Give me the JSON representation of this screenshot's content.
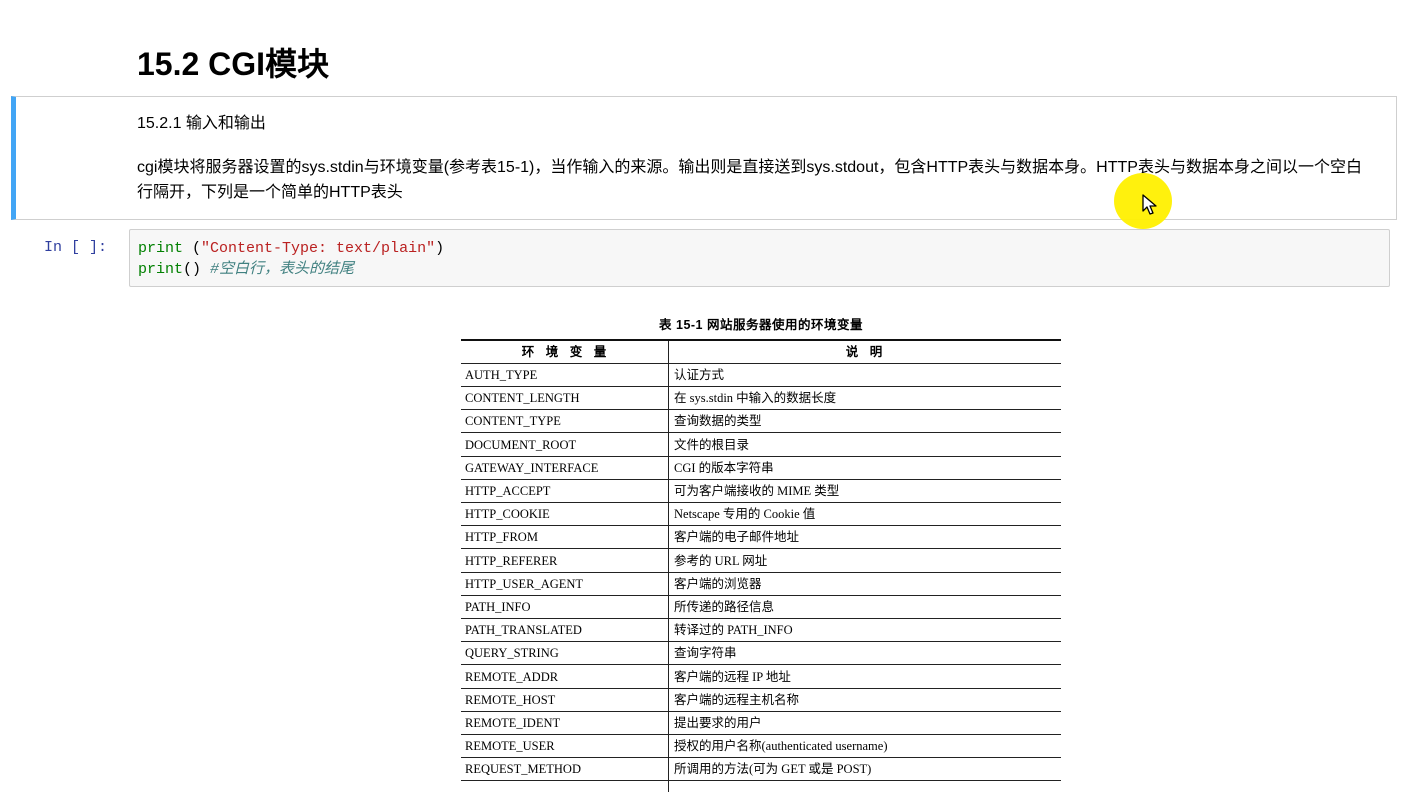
{
  "notebook": {
    "heading": "15.2 CGI模块",
    "markdown_cell": {
      "subheading": "15.2.1 输入和输出",
      "paragraph": "cgi模块将服务器设置的sys.stdin与环境变量(参考表15-1)，当作输入的来源。输出则是直接送到sys.stdout，包含HTTP表头与数据本身。HTTP表头与数据本身之间以一个空白行隔开，下列是一个简单的HTTP表头"
    },
    "code_cell": {
      "prompt": "In [ ]:",
      "line1": {
        "func": "print",
        "open": " (",
        "string": "\"Content-Type: text/plain\"",
        "close": ")"
      },
      "line2": {
        "func": "print",
        "args": "() ",
        "comment": "#空白行，表头的结尾"
      }
    },
    "table_image": {
      "caption": "表 15-1   网站服务器使用的环境变量",
      "headers": [
        "环 境 变 量",
        "说 明"
      ],
      "rows": [
        {
          "name": "AUTH_TYPE",
          "desc": "认证方式"
        },
        {
          "name": "CONTENT_LENGTH",
          "desc": "在 sys.stdin 中输入的数据长度"
        },
        {
          "name": "CONTENT_TYPE",
          "desc": "查询数据的类型"
        },
        {
          "name": "DOCUMENT_ROOT",
          "desc": "文件的根目录"
        },
        {
          "name": "GATEWAY_INTERFACE",
          "desc": "CGI 的版本字符串"
        },
        {
          "name": "HTTP_ACCEPT",
          "desc": "可为客户端接收的 MIME 类型"
        },
        {
          "name": "HTTP_COOKIE",
          "desc": "Netscape 专用的 Cookie 值"
        },
        {
          "name": "HTTP_FROM",
          "desc": "客户端的电子邮件地址"
        },
        {
          "name": "HTTP_REFERER",
          "desc": "参考的 URL 网址"
        },
        {
          "name": "HTTP_USER_AGENT",
          "desc": "客户端的浏览器"
        },
        {
          "name": "PATH_INFO",
          "desc": "所传递的路径信息"
        },
        {
          "name": "PATH_TRANSLATED",
          "desc": "转译过的 PATH_INFO"
        },
        {
          "name": "QUERY_STRING",
          "desc": "查询字符串"
        },
        {
          "name": "REMOTE_ADDR",
          "desc": "客户端的远程 IP 地址"
        },
        {
          "name": "REMOTE_HOST",
          "desc": "客户端的远程主机名称"
        },
        {
          "name": "REMOTE_IDENT",
          "desc": "提出要求的用户"
        },
        {
          "name": "REMOTE_USER",
          "desc": "授权的用户名称(authenticated username)"
        },
        {
          "name": "REQUEST_METHOD",
          "desc": "所调用的方法(可为 GET 或是 POST)"
        }
      ]
    }
  },
  "colors": {
    "selected_cell_bar": "#42a5f5",
    "cursor_highlight": "#fff000",
    "code_background": "#f7f7f7"
  }
}
